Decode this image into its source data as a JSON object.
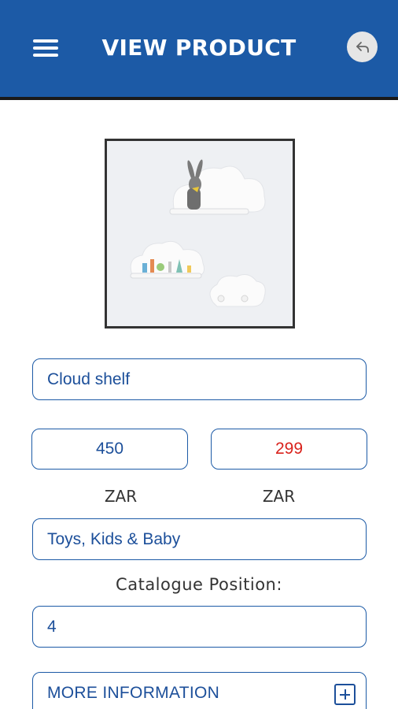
{
  "header": {
    "title": "VIEW PRODUCT",
    "menu_icon": "hamburger-menu-icon",
    "back_icon": "back-arrow-icon",
    "bar_color": "#1c5aa6"
  },
  "product": {
    "image_description_icon": "cloud-shelf-photo",
    "name": "Cloud shelf",
    "price": "450",
    "sale_price": "299",
    "price_currency": "ZAR",
    "sale_currency": "ZAR",
    "category": "Toys, Kids & Baby",
    "catalogue_position_label": "Catalogue Position:",
    "catalogue_position": "4",
    "more_info_label": "MORE INFORMATION"
  },
  "colors": {
    "accent": "#1c5aa6",
    "sale": "#d9221c"
  }
}
